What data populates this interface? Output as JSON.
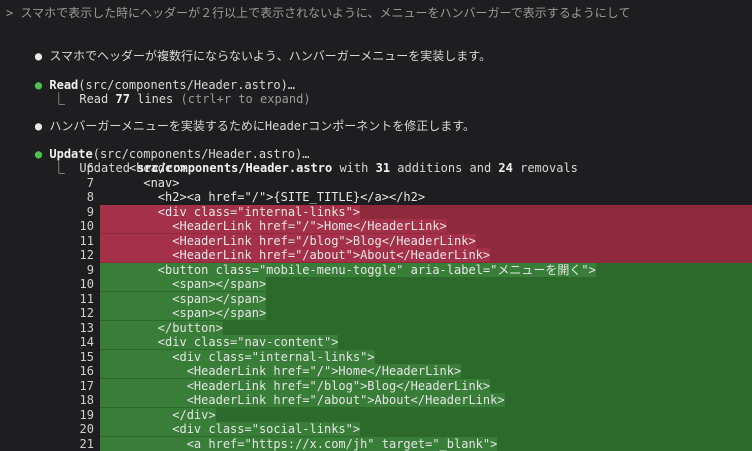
{
  "prompt": "> スマホで表示した時にヘッダーが２行以上で表示されないように、メニューをハンバーガーで表示するようにして",
  "messages": [
    {
      "bullet": "●",
      "text": "スマホでヘッダーが複数行にならないよう、ハンバーガーメニューを実装します。"
    },
    {
      "bullet": "●",
      "tool": "Read",
      "arg": "(src/components/Header.astro)…",
      "result_prefix": "⎿  Read ",
      "result_count": "77",
      "result_suffix": " lines",
      "result_hint": " (ctrl+r to expand)"
    },
    {
      "bullet": "●",
      "text": "ハンバーガーメニューを実装するためにHeaderコンポーネントを修正します。"
    },
    {
      "bullet": "●",
      "tool": "Update",
      "arg": "(src/components/Header.astro)…",
      "result_prefix": "⎿  Updated ",
      "result_file": "src/components/Header.astro",
      "result_mid1": " with ",
      "additions": "31",
      "result_mid2": " additions and ",
      "removals": "24",
      "result_mid3": " removals"
    }
  ],
  "diff": [
    {
      "n": "6",
      "code": "    <header>",
      "type": "ctx"
    },
    {
      "n": "7",
      "code": "      <nav>",
      "type": "ctx"
    },
    {
      "n": "8",
      "code": "        <h2><a href=\"/\">{SITE_TITLE}</a></h2>",
      "type": "ctx"
    },
    {
      "n": "9",
      "code": "        <div class=\"internal-links\">",
      "type": "del"
    },
    {
      "n": "10",
      "code": "          <HeaderLink href=\"/\">Home</HeaderLink>",
      "type": "del"
    },
    {
      "n": "11",
      "code": "          <HeaderLink href=\"/blog\">Blog</HeaderLink>",
      "type": "del"
    },
    {
      "n": "12",
      "code": "          <HeaderLink href=\"/about\">About</HeaderLink>",
      "type": "del"
    },
    {
      "n": "9",
      "code": "        <button class=\"mobile-menu-toggle\" aria-label=\"メニューを開く\">",
      "type": "add"
    },
    {
      "n": "10",
      "code": "          <span></span>",
      "type": "add"
    },
    {
      "n": "11",
      "code": "          <span></span>",
      "type": "add"
    },
    {
      "n": "12",
      "code": "          <span></span>",
      "type": "add"
    },
    {
      "n": "13",
      "code": "        </button>",
      "type": "add"
    },
    {
      "n": "14",
      "code": "        <div class=\"nav-content\">",
      "type": "add"
    },
    {
      "n": "15",
      "code": "          <div class=\"internal-links\">",
      "type": "add"
    },
    {
      "n": "16",
      "code": "            <HeaderLink href=\"/\">Home</HeaderLink>",
      "type": "add"
    },
    {
      "n": "17",
      "code": "            <HeaderLink href=\"/blog\">Blog</HeaderLink>",
      "type": "add"
    },
    {
      "n": "18",
      "code": "            <HeaderLink href=\"/about\">About</HeaderLink>",
      "type": "add"
    },
    {
      "n": "19",
      "code": "          </div>",
      "type": "add"
    },
    {
      "n": "20",
      "code": "          <div class=\"social-links\">",
      "type": "add"
    },
    {
      "n": "21",
      "code": "            <a href=\"https://x.com/jh\" target=\"_blank\">",
      "type": "add"
    }
  ],
  "colors": {
    "background": "#1e1e20",
    "removed": "#a4304a",
    "added": "#387d38",
    "bullet_tool": "#4cc24c"
  }
}
